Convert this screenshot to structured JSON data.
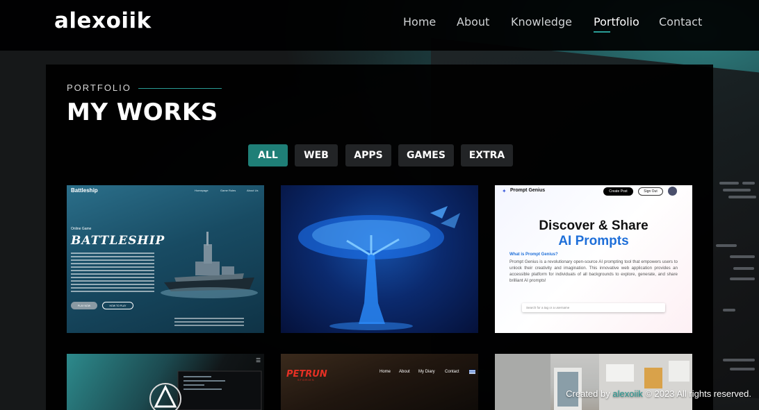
{
  "brand": {
    "logo": "alexoiik"
  },
  "nav": {
    "items": [
      {
        "label": "Home",
        "active": false
      },
      {
        "label": "About",
        "active": false
      },
      {
        "label": "Knowledge",
        "active": false
      },
      {
        "label": "Portfolio",
        "active": true
      },
      {
        "label": "Contact",
        "active": false
      }
    ]
  },
  "section": {
    "eyebrow": "PORTFOLIO",
    "title": "MY WORKS"
  },
  "filters": [
    {
      "label": "ALL",
      "active": true
    },
    {
      "label": "WEB",
      "active": false
    },
    {
      "label": "APPS",
      "active": false
    },
    {
      "label": "GAMES",
      "active": false
    },
    {
      "label": "EXTRA",
      "active": false
    }
  ],
  "cards": {
    "battleship": {
      "brand": "Battleship",
      "nav": [
        "Homepage",
        "Game Rules",
        "About Us"
      ],
      "tag": "Online Game",
      "title": "BATTLESHIP",
      "play_button": "PLAY NOW",
      "howto_button": "HOW TO PLAY"
    },
    "prompt_genius": {
      "brand": "Prompt Genius",
      "create_button": "Create Post",
      "signout_button": "Sign Out",
      "headline_1": "Discover & Share",
      "headline_2": "AI Prompts",
      "question": "What is Prompt Genius?",
      "description": "Prompt Genius is a revolutionary open-source AI prompting tool that empowers users to unlock their creativity and imagination. This innovative web application provides an accessible platform for individuals of all backgrounds to explore, generate, and share brilliant AI prompts!",
      "search_placeholder": "Search for a tag or a username"
    },
    "petrun": {
      "logo": "PETRUN",
      "logo_sub": "STORIES",
      "nav": [
        "Home",
        "About",
        "My Diary",
        "Contact"
      ]
    }
  },
  "footer": {
    "prefix": "Created by",
    "author": "alexoiik",
    "suffix": "© 2023 All rights reserved."
  },
  "colors": {
    "accent": "#2a9d96",
    "filter_active": "#1f7f77",
    "filter_inactive": "#222426"
  }
}
